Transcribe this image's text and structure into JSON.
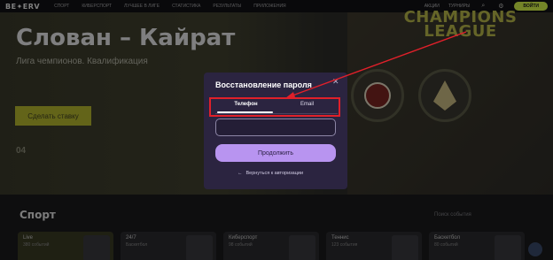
{
  "topbar": {
    "logo": "BE✦ERV",
    "nav": [
      "СПОРТ",
      "КИБЕРСПОРТ",
      "ЛУЧШЕЕ В ЛИГЕ",
      "СТАТИСТИКА",
      "РЕЗУЛЬТАТЫ",
      "ПРИЛОЖЕНИЯ"
    ],
    "right_links": [
      "АКЦИИ",
      "ТУРНИРЫ"
    ],
    "register_label": "ВОЙТИ"
  },
  "hero": {
    "title": "Слован – Кайрат",
    "subtitle": "Лига чемпионов. Квалификация",
    "bet_button": "Сделать ставку",
    "time": "04",
    "champions_text": "CHAMPIONS LEAGUE"
  },
  "sport_section": {
    "title": "Спорт",
    "search_label": "Поиск события",
    "cards": [
      {
        "title": "Live",
        "subtitle": "380 событий"
      },
      {
        "title": "24/7",
        "subtitle": "Баскетбол"
      },
      {
        "title": "Киберспорт",
        "subtitle": "98 событий"
      },
      {
        "title": "Теннис",
        "subtitle": "123 события"
      },
      {
        "title": "Баскетбол",
        "subtitle": "80 событий"
      }
    ]
  },
  "modal": {
    "title": "Восстановление пароля",
    "tabs": [
      {
        "label": "Телефон",
        "active": true
      },
      {
        "label": "Email",
        "active": false
      }
    ],
    "phone_value": "",
    "continue_label": "Продолжить",
    "back_label": "Вернуться к авторизации"
  },
  "colors": {
    "modal_bg": "#2b2440",
    "button_accent": "#b894f0",
    "annotation_red": "#e0202a",
    "brand_lime": "#d4f34a"
  }
}
